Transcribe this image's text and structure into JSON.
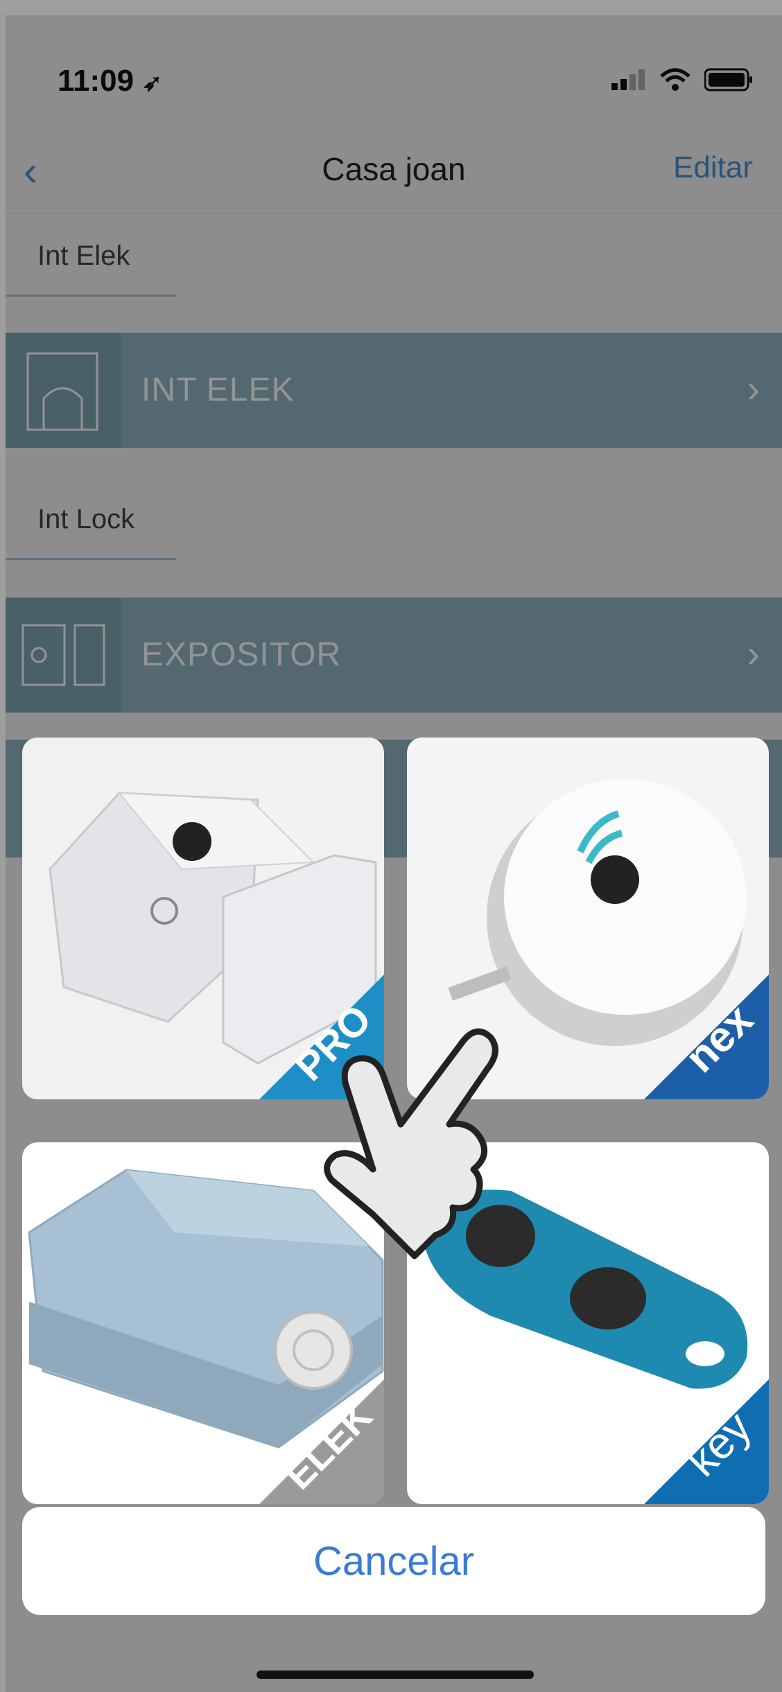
{
  "status": {
    "time": "11:09"
  },
  "nav": {
    "back": "‹",
    "title": "Casa joan",
    "edit": "Editar"
  },
  "sections": [
    {
      "label": "Int Elek",
      "row": "INT ELEK"
    },
    {
      "label": "Int Lock",
      "row": "EXPOSITOR"
    }
  ],
  "products": [
    {
      "name": "lock-pro",
      "ribbon": "PRO",
      "ribbon_color": "#1e8fc6"
    },
    {
      "name": "nex-hub",
      "ribbon": "nex",
      "ribbon_color": "#1c5fa8"
    },
    {
      "name": "lock-elek",
      "ribbon": "ELEK",
      "ribbon_color": "#9a9a9a"
    },
    {
      "name": "key-fob",
      "ribbon": "key",
      "ribbon_color": "#0f6db1"
    }
  ],
  "cancel": "Cancelar",
  "colors": {
    "accent": "#3a7bd5",
    "row": "#8fb4c2"
  }
}
